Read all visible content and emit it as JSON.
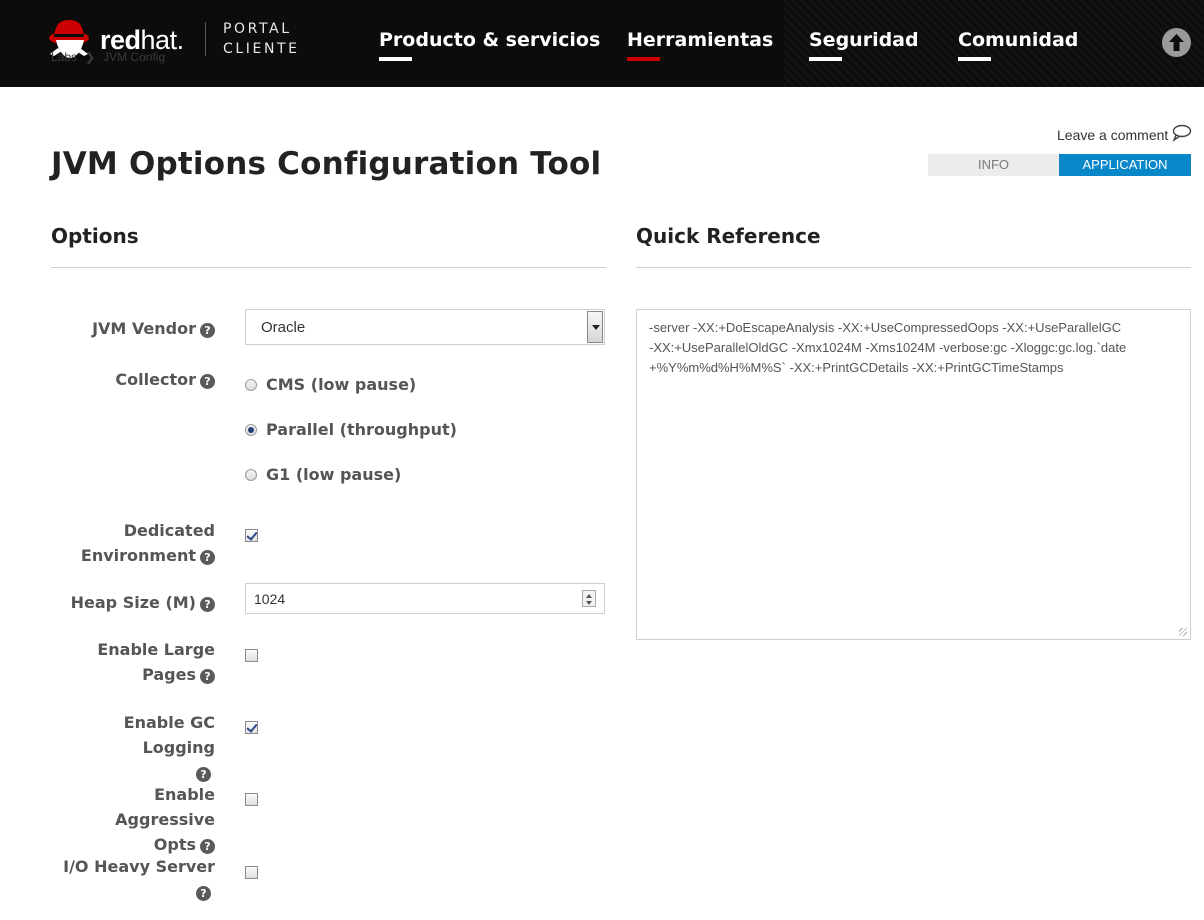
{
  "header": {
    "logo_text": "redhat.",
    "logo_bold": "red",
    "logo_light": "hat.",
    "portal_line1": "PORTAL",
    "portal_line2": "CLIENTE",
    "breadcrumb": [
      "Labs",
      "JVM Config"
    ],
    "nav": [
      {
        "label": "Producto & servicios",
        "active": false
      },
      {
        "label": "Herramientas",
        "active": true
      },
      {
        "label": "Seguridad",
        "active": false
      },
      {
        "label": "Comunidad",
        "active": false
      }
    ],
    "scroll_top_icon": "arrow-up-circle-icon",
    "colors": {
      "background": "#0c0c0c",
      "active_underline": "#cc0000"
    }
  },
  "page": {
    "title": "JVM Options Configuration Tool",
    "comment_link": "Leave a comment",
    "comment_icon": "speech-bubble-icon",
    "tabs": [
      {
        "label": "INFO",
        "selected": false
      },
      {
        "label": "APPLICATION",
        "selected": true
      }
    ],
    "accent_color": "#0a87c9"
  },
  "options": {
    "heading": "Options",
    "vendor_label": "JVM Vendor",
    "vendor_value": "Oracle",
    "collector_label": "Collector",
    "collectors": [
      {
        "label": "CMS (low pause)",
        "selected": false
      },
      {
        "label": "Parallel (throughput)",
        "selected": true
      },
      {
        "label": "G1 (low pause)",
        "selected": false
      }
    ],
    "dedicated_label_1": "Dedicated",
    "dedicated_label_2": "Environment",
    "dedicated_checked": true,
    "heap_label": "Heap Size (M)",
    "heap_value": "1024",
    "large_pages_label_1": "Enable Large",
    "large_pages_label_2": "Pages",
    "large_pages_checked": false,
    "gc_logging_label": "Enable GC Logging",
    "gc_logging_checked": true,
    "aggressive_label_1": "Enable Aggressive",
    "aggressive_label_2": "Opts",
    "aggressive_checked": false,
    "io_heavy_label": "I/O Heavy Server",
    "io_heavy_checked": false
  },
  "quick_reference": {
    "heading": "Quick Reference",
    "line1": "-server -XX:+DoEscapeAnalysis -XX:+UseCompressedOops -XX:+UseParallelGC",
    "line2": "-XX:+UseParallelOldGC -Xmx1024M -Xms1024M -verbose:gc -Xloggc:gc.log.`date",
    "line3": "+%Y%m%d%H%M%S` -XX:+PrintGCDetails -XX:+PrintGCTimeStamps"
  }
}
